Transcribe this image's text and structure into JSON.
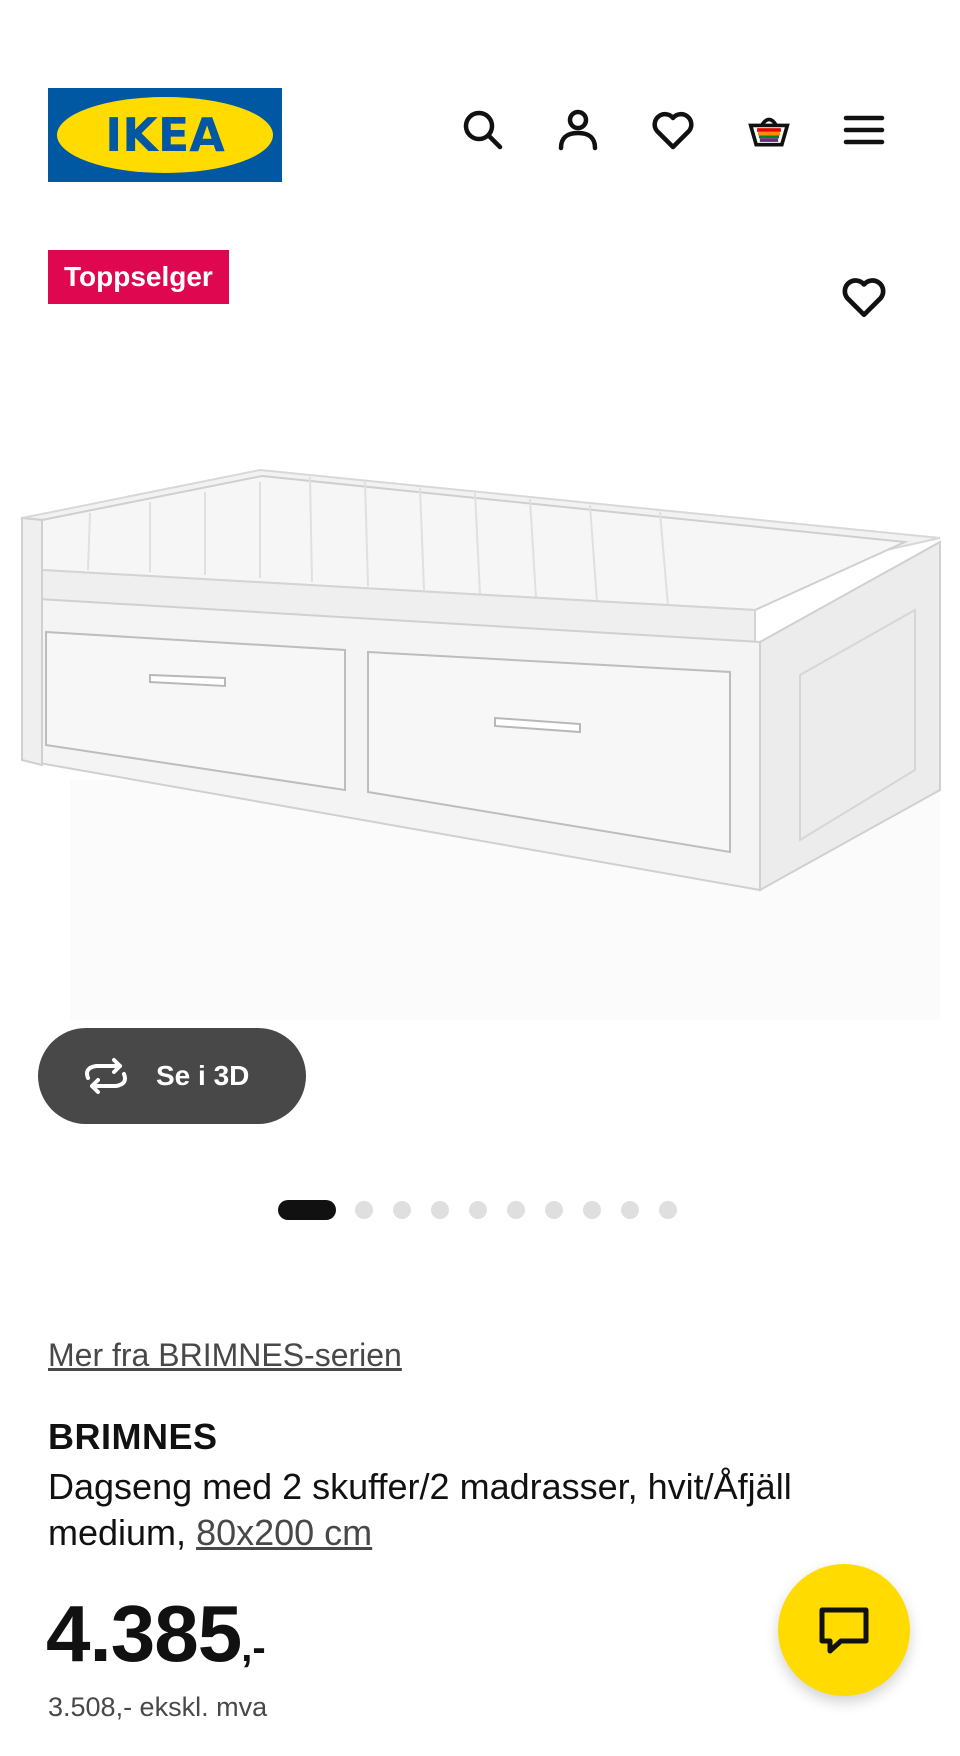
{
  "header": {
    "logo_text": "IKEA",
    "icons": [
      "search-icon",
      "user-icon",
      "heart-icon",
      "basket-icon",
      "menu-icon"
    ]
  },
  "badge": {
    "label": "Toppselger",
    "color": "#e00751"
  },
  "gallery": {
    "view_3d_label": "Se i 3D",
    "image_count": 10,
    "active_index": 0
  },
  "product": {
    "series_link": "Mer fra BRIMNES-serien",
    "name": "BRIMNES",
    "description": "Dagseng med 2 skuffer/2 madrasser, hvit/Åfjäll medium,",
    "size": "80x200 cm",
    "price_integer": "4.385",
    "price_decimal": ",-",
    "price_ex_vat": "3.508,- ekskl. mva"
  },
  "colors": {
    "ikea_blue": "#0058a3",
    "ikea_yellow": "#ffdb00",
    "badge_red": "#e00751",
    "btn_3d_bg": "#484848"
  }
}
